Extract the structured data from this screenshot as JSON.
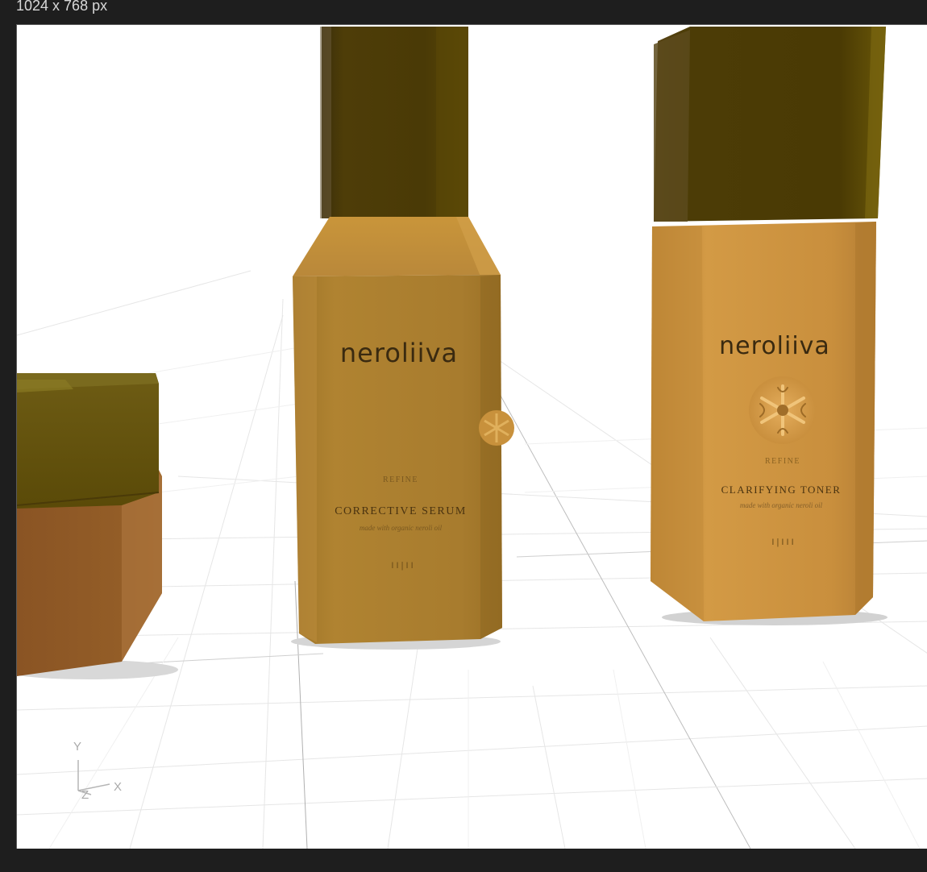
{
  "window": {
    "dimensions_label": "1024 x 768 px"
  },
  "products": {
    "serum": {
      "brand": "neroliiva",
      "line": "REFINE",
      "name": "CORRECTIVE SERUM",
      "note": "made with organic neroli oil",
      "mark": "I I | I I"
    },
    "toner": {
      "brand": "neroliiva",
      "line": "REFINE",
      "name": "CLARIFYING TONER",
      "note": "made with organic neroli oil",
      "mark": "I | I I I"
    }
  },
  "axes": {
    "y": "Y",
    "x": "X",
    "z": "Z"
  },
  "colors": {
    "background": "#1e1e1e",
    "viewport": "#ffffff",
    "bottle_body": "#b8862f",
    "bottle_cap": "#4a3a08",
    "toner_body": "#c98f3d",
    "jar_body": "#8f5a25",
    "jar_lid": "#6a5a10"
  },
  "icons": [
    "flower-emblem-icon",
    "axis-gizmo-icon"
  ]
}
